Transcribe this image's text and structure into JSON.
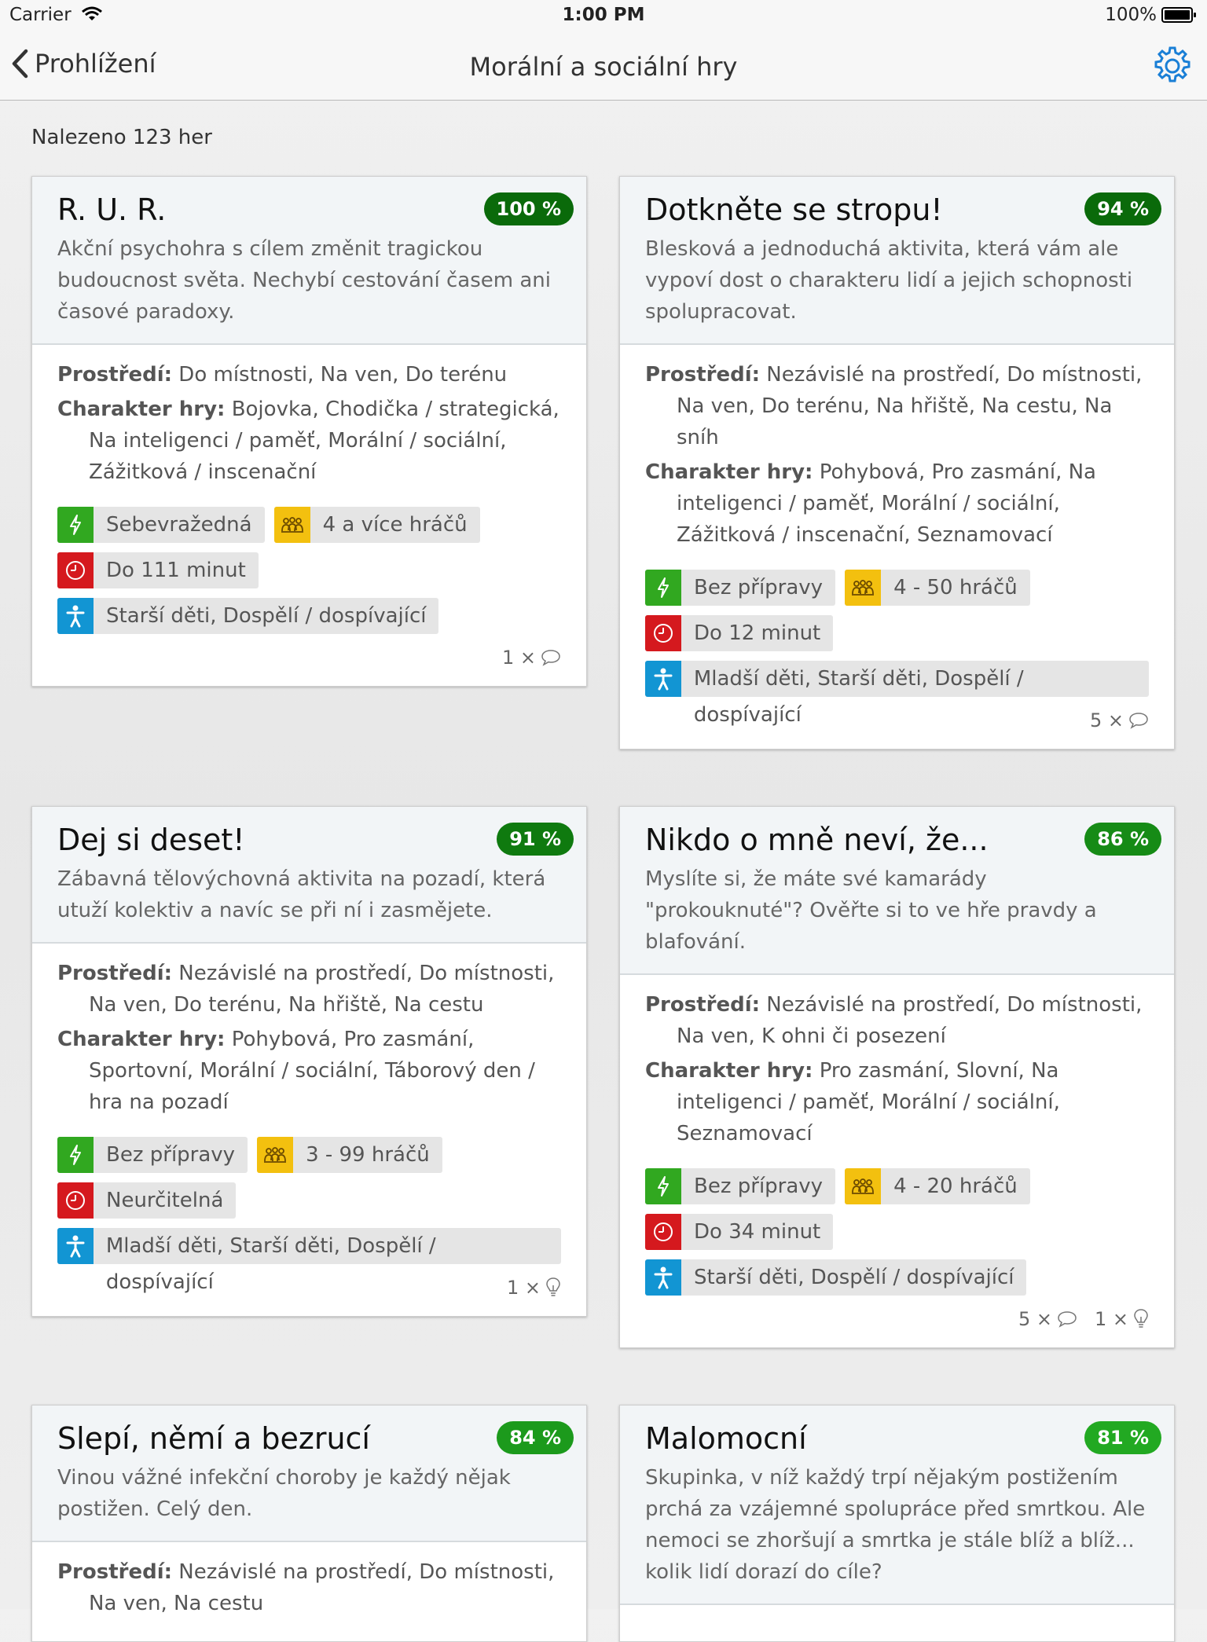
{
  "status": {
    "carrier": "Carrier",
    "time": "1:00 PM",
    "battery": "100%"
  },
  "nav": {
    "back_label": "Prohlížení",
    "title": "Morální a sociální hry"
  },
  "found": "Nalezeno 123 her",
  "colors": {
    "pct_dark": "#0a6a0a",
    "pct_mid": "#168b16",
    "pct_light": "#22a922",
    "accent": "#1a7fd6"
  },
  "cards": [
    {
      "title": "R. U. R.",
      "pct": "100 %",
      "desc": "Akční psychohra s cílem změnit tragickou budoucnost světa. Nechybí cestování časem ani časové paradoxy.",
      "env_label": "Prostředí:",
      "env": "Do místnosti, Na ven, Do terénu",
      "char_label": "Charakter hry:",
      "char": "Bojovka, Chodička / strategická, Na inteligenci / paměť, Morální / sociální, Zážitková / inscenační",
      "prep": "Sebevražedná",
      "players": "4 a více hráčů",
      "time": "Do 111 minut",
      "age": "Starší děti, Dospělí / dospívající",
      "comments": "1 ×",
      "ideas": ""
    },
    {
      "title": "Dotkněte se stropu!",
      "pct": "94 %",
      "desc": "Blesková a jednoduchá aktivita, která vám ale vypoví dost o charakteru lidí a jejich schopnosti spolupracovat.",
      "env_label": "Prostředí:",
      "env": "Nezávislé na prostředí, Do místnosti, Na ven, Do terénu, Na hřiště, Na cestu, Na sníh",
      "char_label": "Charakter hry:",
      "char": "Pohybová, Pro zasmání, Na inteligenci / paměť, Morální / sociální, Zážitková / inscenační, Seznamovací",
      "prep": "Bez přípravy",
      "players": "4 - 50 hráčů",
      "time": "Do 12 minut",
      "age": "Mladší děti, Starší děti, Dospělí / dospívající",
      "comments": "5 ×",
      "ideas": ""
    },
    {
      "title": "Dej si deset!",
      "pct": "91 %",
      "desc": "Zábavná tělovýchovná aktivita na pozadí, která utuží kolektiv a navíc se při ní i zasmějete.",
      "env_label": "Prostředí:",
      "env": "Nezávislé na prostředí, Do místnosti, Na ven, Do terénu, Na hřiště, Na cestu",
      "char_label": "Charakter hry:",
      "char": "Pohybová, Pro zasmání, Sportovní, Morální / sociální, Táborový den / hra na pozadí",
      "prep": "Bez přípravy",
      "players": "3 - 99 hráčů",
      "time": "Neurčitelná",
      "age": "Mladší děti, Starší děti, Dospělí / dospívající",
      "comments": "",
      "ideas": "1 ×"
    },
    {
      "title": "Nikdo o mně neví, že...",
      "pct": "86 %",
      "desc": "Myslíte si, že máte své kamarády \"prokouknuté\"? Ověřte si to ve hře pravdy a blafování.",
      "env_label": "Prostředí:",
      "env": "Nezávislé na prostředí, Do místnosti, Na ven, K ohni či posezení",
      "char_label": "Charakter hry:",
      "char": "Pro zasmání, Slovní, Na inteligenci / paměť, Morální / sociální, Seznamovací",
      "prep": "Bez přípravy",
      "players": "4 - 20 hráčů",
      "time": "Do 34 minut",
      "age": "Starší děti, Dospělí / dospívající",
      "comments": "5 ×",
      "ideas": "1 ×"
    },
    {
      "title": "Slepí, němí a bezrucí",
      "pct": "84 %",
      "desc": "Vinou vážné infekční choroby je každý nějak postižen. Celý den.",
      "env_label": "Prostředí:",
      "env": "Nezávislé na prostředí, Do místnosti, Na ven, Na cestu",
      "char_label": "",
      "char": "",
      "prep": "",
      "players": "",
      "time": "",
      "age": "",
      "comments": "",
      "ideas": ""
    },
    {
      "title": "Malomocní",
      "pct": "81 %",
      "desc": "Skupinka, v níž každý trpí nějakým postižením prchá za vzájemné spolupráce před smrtkou. Ale nemoci se zhoršují a smrtka je stále blíž a blíž... kolik lidí dorazí do cíle?",
      "env_label": "",
      "env": "",
      "char_label": "",
      "char": "",
      "prep": "",
      "players": "",
      "time": "",
      "age": "",
      "comments": "",
      "ideas": ""
    }
  ]
}
